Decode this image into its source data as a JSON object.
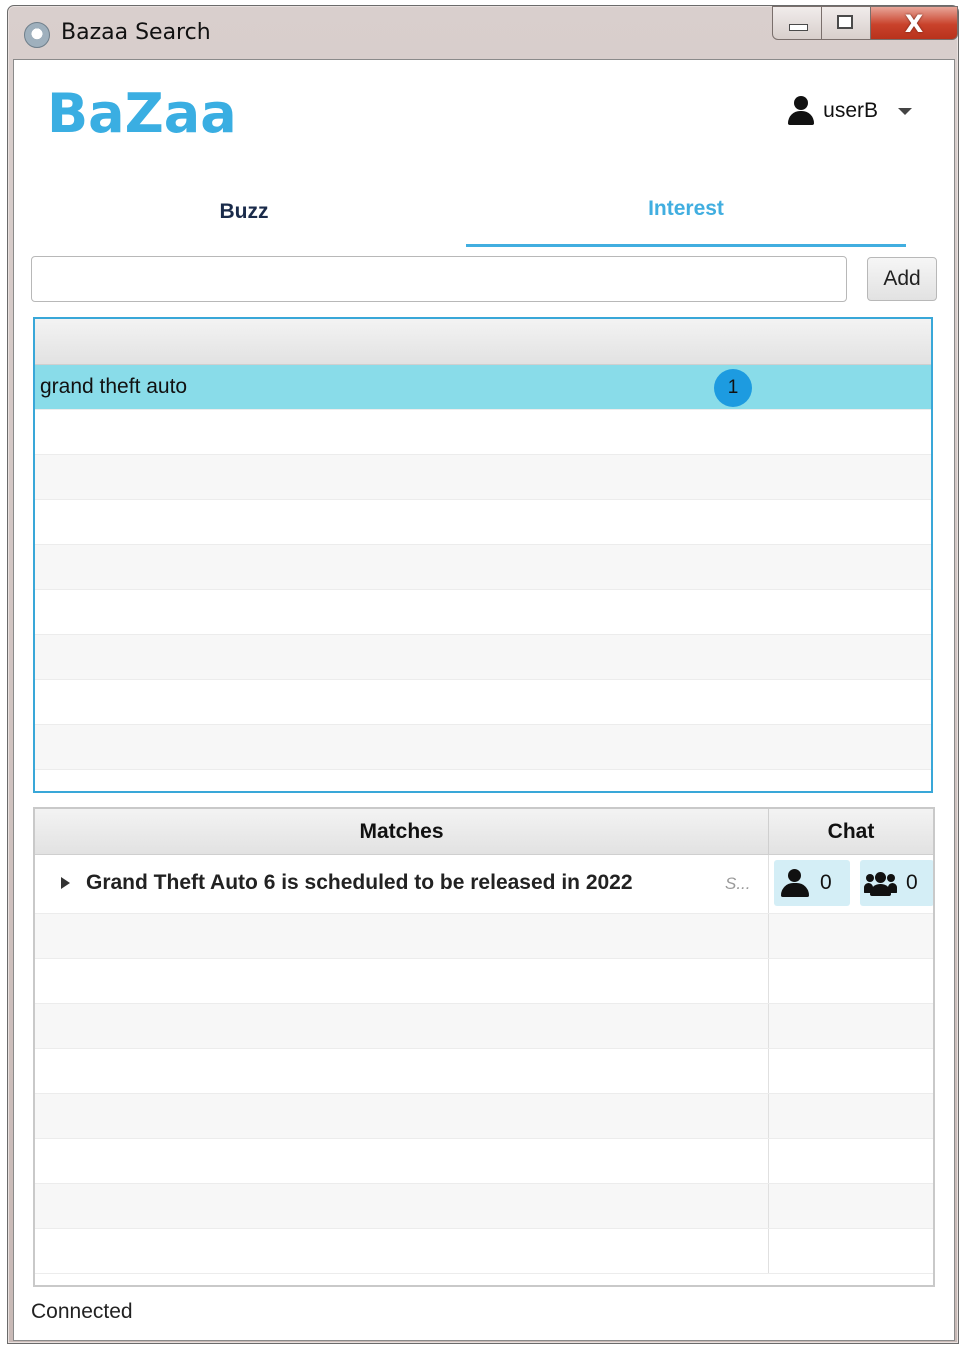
{
  "window": {
    "title": "Bazaa Search",
    "close_glyph": "X"
  },
  "header": {
    "logo": "BaZaa",
    "username": "userB"
  },
  "tabs": [
    {
      "label": "Buzz",
      "active": false
    },
    {
      "label": "Interest",
      "active": true
    }
  ],
  "add_bar": {
    "input_value": "",
    "button_label": "Add"
  },
  "interests": {
    "rows": [
      {
        "label": "grand theft auto",
        "badge": "1",
        "selected": true
      }
    ]
  },
  "matches": {
    "headers": {
      "matches": "Matches",
      "chat": "Chat"
    },
    "rows": [
      {
        "title": "Grand Theft Auto 6 is scheduled to be released in 2022",
        "source": "S...",
        "single_chats": "0",
        "group_chats": "0"
      }
    ]
  },
  "status": "Connected",
  "colors": {
    "accent": "#41aee0",
    "selected_row": "#89dce9",
    "badge": "#1d9be0",
    "chat_pill": "#d4eef6"
  },
  "icons": {
    "user": "user-icon",
    "group": "group-icon",
    "dropdown": "chevron-down-icon",
    "expander": "expand-arrow-icon"
  }
}
